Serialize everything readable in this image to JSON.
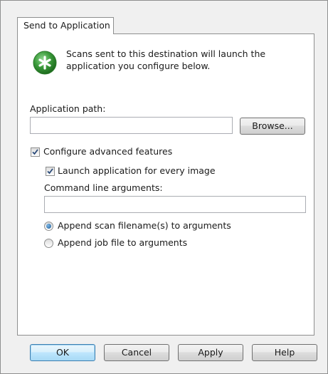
{
  "tab": {
    "label": "Send to Application"
  },
  "info": {
    "line1": "Scans sent to this destination will launch the",
    "line2": "application you configure below."
  },
  "app_path": {
    "label": "Application path:",
    "value": "",
    "browse_label": "Browse..."
  },
  "advanced": {
    "label": "Configure advanced features",
    "checked": true
  },
  "launch_every": {
    "label": "Launch application for every image",
    "checked": true
  },
  "command_line": {
    "label": "Command line arguments:",
    "value": ""
  },
  "radios": {
    "append_scan": {
      "label": "Append scan filename(s) to arguments",
      "selected": true
    },
    "append_job": {
      "label": "Append job file to arguments",
      "selected": false
    }
  },
  "buttons": {
    "ok": "OK",
    "cancel": "Cancel",
    "apply": "Apply",
    "help": "Help"
  },
  "colors": {
    "icon_green": "#3a9a3a",
    "accent_blue": "#3c7fb1"
  },
  "icons": {
    "info": "green-asterisk-icon"
  }
}
